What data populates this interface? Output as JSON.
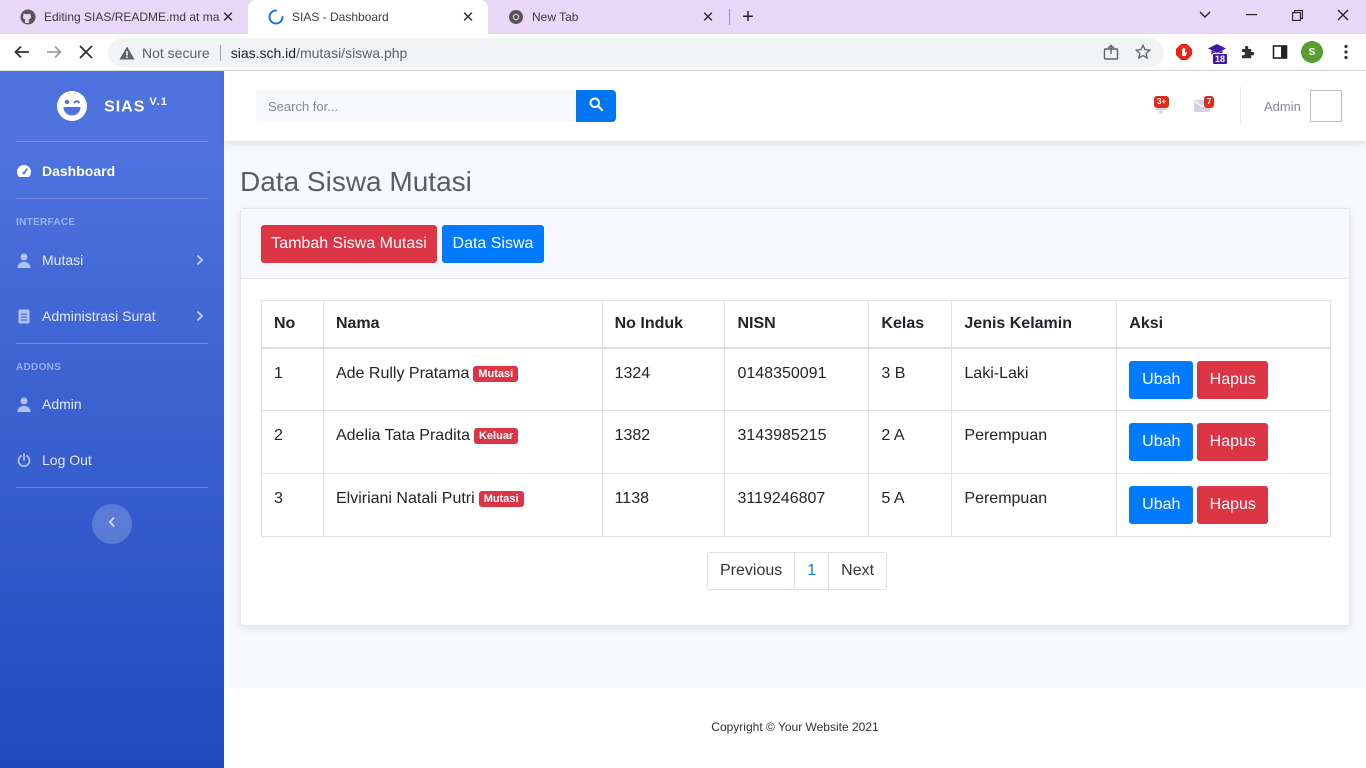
{
  "browser": {
    "tabs": [
      {
        "title": "Editing SIAS/README.md at mas",
        "icon": "github-icon"
      },
      {
        "title": "SIAS - Dashboard",
        "icon": "loading-spinner-icon"
      },
      {
        "title": "New Tab",
        "icon": "chrome-icon"
      }
    ],
    "security_label": "Not secure",
    "url_host": "sias.sch.id",
    "url_path": "/mutasi/siswa.php",
    "extension_badge": "18",
    "profile_initial": "S"
  },
  "sidebar": {
    "brand": "SIAS",
    "version": "V.1",
    "dashboard": "Dashboard",
    "heading_interface": "INTERFACE",
    "mutasi": "Mutasi",
    "administrasi": "Administrasi Surat",
    "heading_addons": "ADDONS",
    "admin": "Admin",
    "logout": "Log Out"
  },
  "topbar": {
    "search_placeholder": "Search for...",
    "alerts_badge": "3+",
    "messages_badge": "7",
    "user_name": "Admin"
  },
  "page": {
    "title": "Data Siswa Mutasi",
    "btn_tambah": "Tambah Siswa Mutasi",
    "btn_data_siswa": "Data Siswa"
  },
  "table": {
    "headers": [
      "No",
      "Nama",
      "No Induk",
      "NISN",
      "Kelas",
      "Jenis Kelamin",
      "Aksi"
    ],
    "rows": [
      {
        "no": "1",
        "nama": "Ade Rully Pratama",
        "status": "Mutasi",
        "no_induk": "1324",
        "nisn": "0148350091",
        "kelas": "3 B",
        "jk": "Laki-Laki"
      },
      {
        "no": "2",
        "nama": "Adelia Tata Pradita",
        "status": "Keluar",
        "no_induk": "1382",
        "nisn": "3143985215",
        "kelas": "2 A",
        "jk": "Perempuan"
      },
      {
        "no": "3",
        "nama": "Elviriani Natali Putri",
        "status": "Mutasi",
        "no_induk": "1138",
        "nisn": "3119246807",
        "kelas": "5 A",
        "jk": "Perempuan"
      }
    ],
    "btn_ubah": "Ubah",
    "btn_hapus": "Hapus"
  },
  "pagination": {
    "previous": "Previous",
    "current": "1",
    "next": "Next"
  },
  "footer": {
    "copyright": "Copyright © Your Website 2021"
  },
  "colors": {
    "primary": "#4e73df",
    "danger": "#dc3545",
    "blue": "#007bff"
  }
}
